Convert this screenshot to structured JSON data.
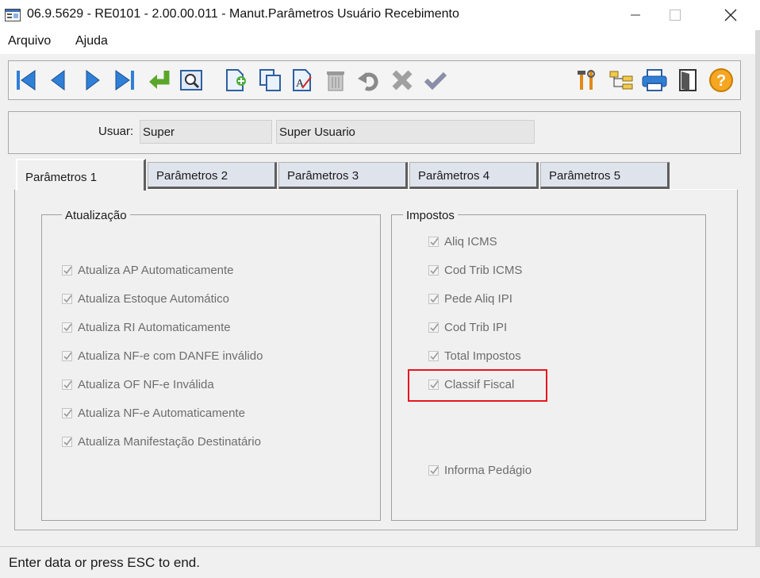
{
  "window": {
    "title": "06.9.5629 - RE0101 - 2.00.00.011 - Manut.Parâmetros Usuário Recebimento",
    "icon": "app-window-icon",
    "controls": [
      "minimize-icon",
      "maximize-icon",
      "close-icon"
    ]
  },
  "menu": {
    "items": [
      {
        "label": "Arquivo"
      },
      {
        "label": "Ajuda"
      }
    ]
  },
  "toolbar": {
    "buttons": [
      "first-record-icon",
      "previous-record-icon",
      "next-record-icon",
      "last-record-icon",
      "goto-icon",
      "search-icon",
      "new-record-icon",
      "copy-record-icon",
      "edit-record-icon",
      "delete-record-icon",
      "undo-icon",
      "cancel-icon",
      "confirm-icon",
      "tools-icon",
      "tree-icon",
      "print-icon",
      "exit-icon",
      "help-icon"
    ]
  },
  "user": {
    "label": "Usuar:",
    "code": "Super",
    "name": "Super Usuario"
  },
  "tabs": [
    {
      "label": "Parâmetros 1",
      "active": true
    },
    {
      "label": "Parâmetros 2"
    },
    {
      "label": "Parâmetros 3"
    },
    {
      "label": "Parâmetros 4"
    },
    {
      "label": "Parâmetros 5"
    }
  ],
  "atualizacao": {
    "title": "Atualização",
    "items": [
      {
        "label": "Atualiza AP Automaticamente",
        "checked": true
      },
      {
        "label": "Atualiza Estoque Automático",
        "checked": true
      },
      {
        "label": "Atualiza RI Automaticamente",
        "checked": true
      },
      {
        "label": "Atualiza NF-e com DANFE inválido",
        "checked": true
      },
      {
        "label": "Atualiza OF NF-e Inválida",
        "checked": true
      },
      {
        "label": "Atualiza NF-e Automaticamente",
        "checked": true
      },
      {
        "label": "Atualiza Manifestação Destinatário",
        "checked": true
      }
    ]
  },
  "impostos": {
    "title": "Impostos",
    "items": [
      {
        "label": "Aliq ICMS",
        "checked": true
      },
      {
        "label": "Cod Trib ICMS",
        "checked": true
      },
      {
        "label": "Pede Aliq IPI",
        "checked": true
      },
      {
        "label": "Cod Trib IPI",
        "checked": true
      },
      {
        "label": "Total Impostos",
        "checked": true
      },
      {
        "label": "Classif Fiscal",
        "checked": true
      },
      {
        "label": "Informa Pedágio",
        "checked": true
      }
    ]
  },
  "highlight_color": "#e8161f",
  "status": {
    "text": "Enter data or press ESC to end."
  }
}
